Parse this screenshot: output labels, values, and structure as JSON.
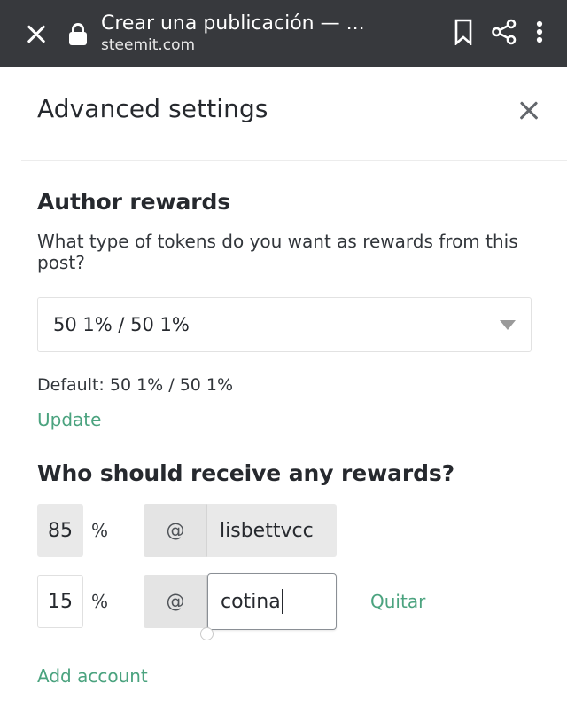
{
  "browser_bar": {
    "close_icon": "close-icon",
    "lock_icon": "lock-icon",
    "page_title": "Crear una publicación — ...",
    "origin": "steemit.com",
    "bookmark_icon": "bookmark-icon",
    "share_icon": "share-icon",
    "overflow_icon": "more-vertical-icon",
    "background_color": "#37393d"
  },
  "dialog": {
    "title": "Advanced settings",
    "close_icon": "close-icon"
  },
  "author_rewards": {
    "heading": "Author rewards",
    "description": "What type of tokens do you want as rewards from this post?",
    "select_value": "50 1% / 50 1%",
    "select_arrow_icon": "chevron-down-icon",
    "default_text": "Default: 50 1% / 50 1%",
    "update_label": "Update"
  },
  "beneficiaries": {
    "heading": "Who should receive any rewards?",
    "percent_sign": "%",
    "at_prefix": "@",
    "rows": [
      {
        "percent": "85",
        "username": "lisbettvcc",
        "state": "disabled",
        "remove_label": ""
      },
      {
        "percent": "15",
        "username": "cotina",
        "state": "focused",
        "remove_label": "Quitar"
      }
    ],
    "add_account_label": "Add account"
  },
  "colors": {
    "link_teal": "#4ba37f",
    "text_dark": "#26292e",
    "bar_dark": "#37393d"
  }
}
